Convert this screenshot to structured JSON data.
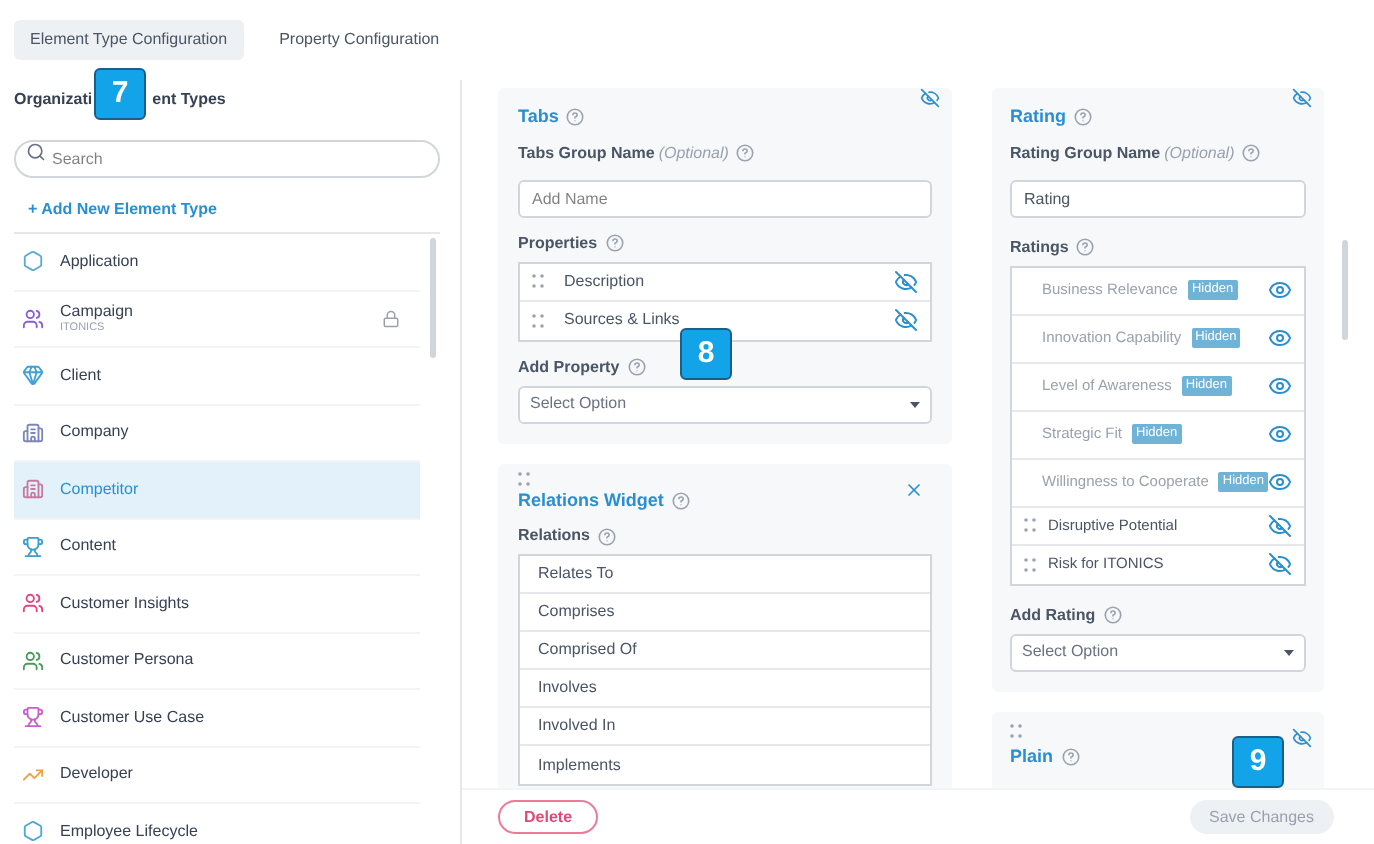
{
  "top_tabs": [
    {
      "label": "Element Type Configuration",
      "selected": true
    },
    {
      "label": "Property Configuration",
      "selected": false
    }
  ],
  "sidebar": {
    "heading_parts": [
      "Organizati",
      "ent Types"
    ],
    "search": {
      "placeholder": "Search"
    },
    "add_link": "+ Add New Element Type",
    "items": [
      {
        "label": "Application",
        "color": "#5aa9d6",
        "selected": false,
        "locked": false
      },
      {
        "label": "Campaign",
        "subtitle": "ITONICS",
        "color": "#8a5cd8",
        "selected": false,
        "locked": true
      },
      {
        "label": "Client",
        "color": "#3ea0d8",
        "selected": false,
        "locked": false
      },
      {
        "label": "Company",
        "color": "#7d86b8",
        "selected": false,
        "locked": false
      },
      {
        "label": "Competitor",
        "color": "#c77aa0",
        "selected": true,
        "locked": false
      },
      {
        "label": "Content",
        "color": "#3a9fd0",
        "selected": false,
        "locked": false
      },
      {
        "label": "Customer Insights",
        "color": "#e0457e",
        "selected": false,
        "locked": false
      },
      {
        "label": "Customer Persona",
        "color": "#4b9a5a",
        "selected": false,
        "locked": false
      },
      {
        "label": "Customer Use Case",
        "color": "#c760c8",
        "selected": false,
        "locked": false
      },
      {
        "label": "Developer",
        "color": "#f0a040",
        "selected": false,
        "locked": false
      },
      {
        "label": "Employee Lifecycle",
        "color": "#4aa8d8",
        "selected": false,
        "locked": false
      }
    ]
  },
  "tabs_widget": {
    "title": "Tabs",
    "group_name_label": "Tabs Group Name",
    "optional": "(Optional)",
    "group_name": {
      "placeholder": "Add Name"
    },
    "properties_label": "Properties",
    "properties": [
      {
        "label": "Description",
        "hidden": false
      },
      {
        "label": "Sources & Links",
        "hidden": false
      }
    ],
    "add_label": "Add Property",
    "select": {
      "placeholder": "Select Option"
    }
  },
  "relations_widget": {
    "title": "Relations Widget",
    "relations_label": "Relations",
    "relations": [
      "Relates To",
      "Comprises",
      "Comprised Of",
      "Involves",
      "Involved In",
      "Implements"
    ]
  },
  "rating_widget": {
    "title": "Rating",
    "group_name_label": "Rating Group Name",
    "optional": "(Optional)",
    "group_name": {
      "value": "Rating"
    },
    "ratings_label": "Ratings",
    "ratings": [
      {
        "label": "Business Relevance",
        "hidden": true,
        "badge": "Hidden"
      },
      {
        "label": "Innovation Capability",
        "hidden": true,
        "badge": "Hidden"
      },
      {
        "label": "Level of Awareness",
        "hidden": true,
        "badge": "Hidden"
      },
      {
        "label": "Strategic Fit",
        "hidden": true,
        "badge": "Hidden"
      },
      {
        "label": "Willingness to Cooperate",
        "hidden": true,
        "badge": "Hidden"
      },
      {
        "label": "Disruptive Potential",
        "hidden": false
      },
      {
        "label": "Risk for ITONICS",
        "hidden": false
      }
    ],
    "add_label": "Add Rating",
    "select": {
      "placeholder": "Select Option"
    }
  },
  "plain_widget": {
    "title": "Plain"
  },
  "footer": {
    "delete": "Delete",
    "save": {
      "label": "Save Changes",
      "disabled": true
    }
  },
  "callouts": [
    {
      "label": "7"
    },
    {
      "label": "8"
    },
    {
      "label": "9"
    }
  ]
}
